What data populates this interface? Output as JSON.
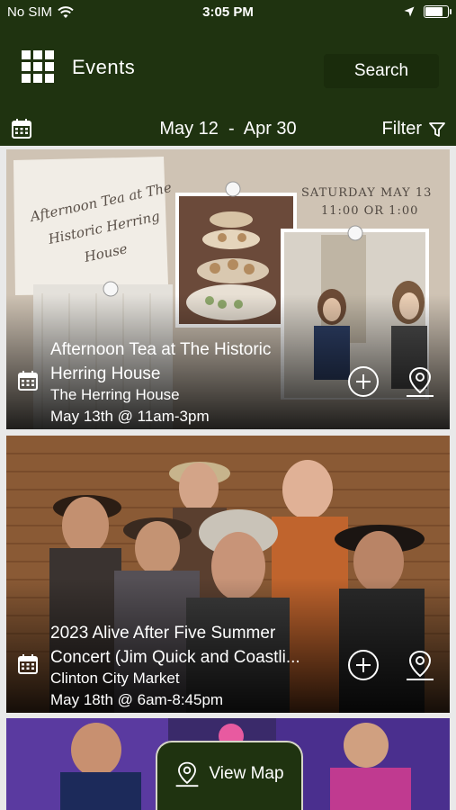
{
  "status_bar": {
    "carrier": "No SIM",
    "time": "3:05 PM",
    "battery_level": 0.85
  },
  "header": {
    "title": "Events",
    "search_label": "Search"
  },
  "date_bar": {
    "start": "May 12",
    "separator": "-",
    "end": "Apr 30",
    "filter_label": "Filter"
  },
  "events": [
    {
      "title_line1": "Afternoon Tea at The Historic",
      "title_line2": "Herring House",
      "venue": "The Herring House",
      "when": "May 13th @ 11am-3pm",
      "flyer": {
        "headline_line1": "Afternoon Tea at The",
        "headline_line2": "Historic Herring",
        "headline_line3": "House",
        "date_line": "SATURDAY MAY 13",
        "times_line": "11:00 OR 1:00"
      }
    },
    {
      "title_line1": "2023 Alive After Five Summer",
      "title_line2": "Concert (Jim Quick and Coastli...",
      "venue": "Clinton City Market",
      "when": "May 18th @ 6am-8:45pm"
    }
  ],
  "map_button": {
    "label": "View Map"
  },
  "colors": {
    "header_bg": "#1f3310",
    "list_bg": "#e9e9e9",
    "text": "#ffffff"
  },
  "icons": [
    "wifi-icon",
    "location-arrow-icon",
    "battery-icon",
    "grid-menu-icon",
    "calendar-icon",
    "filter-icon",
    "add-circle-icon",
    "map-pin-icon"
  ]
}
